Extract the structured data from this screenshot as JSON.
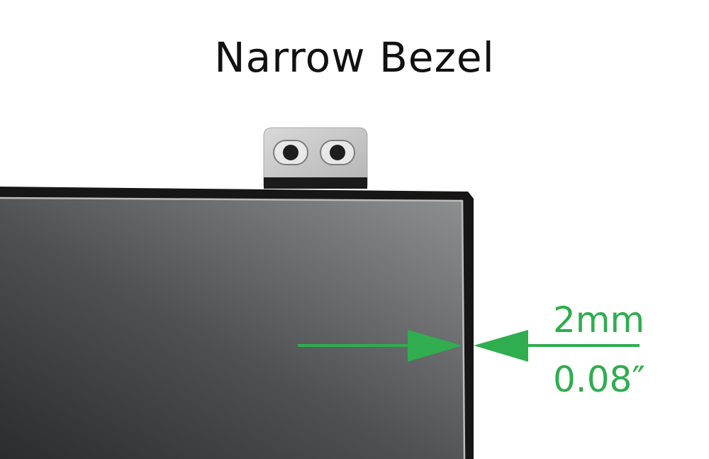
{
  "title": "Narrow Bezel",
  "measurement": {
    "metric": "2mm",
    "imperial": "0.08″"
  },
  "colors": {
    "accent_green": "#2fad4f",
    "panel_dark": "#1a1a1a",
    "bracket_silver": "#c9c9c9"
  }
}
